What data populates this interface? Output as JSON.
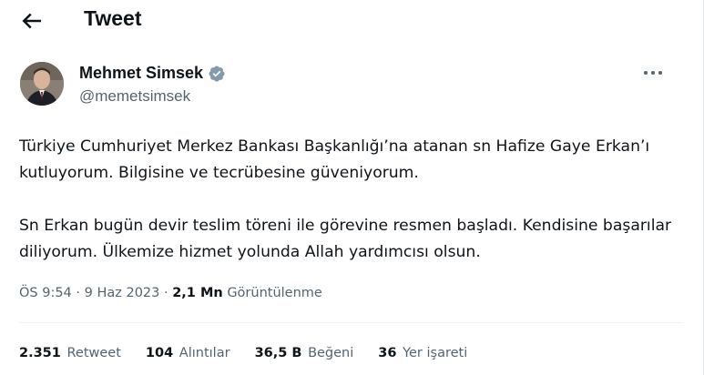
{
  "header": {
    "title": "Tweet",
    "back_icon": "arrow-left-icon"
  },
  "author": {
    "name": "Mehmet Simsek",
    "handle": "@memetsimsek",
    "verified_icon": "verified-badge-icon",
    "verified_color": "#829aab",
    "more_icon": "more-horizontal-icon"
  },
  "tweet": {
    "paragraph_1": "Türkiye Cumhuriyet Merkez Bankası Başkanlığı’na atanan sn Hafize Gaye Erkan’ı kutluyorum. Bilgisine ve tecrübesine güveniyorum.",
    "paragraph_2": "Sn Erkan bugün devir teslim töreni ile görevine resmen başladı. Kendisine başarılar diliyorum. Ülkemize hizmet yolunda Allah yardımcısı olsun."
  },
  "meta": {
    "time": "ÖS 9:54",
    "separator_1": " · ",
    "date": "9 Haz 2023",
    "separator_2": " · ",
    "views_count": "2,1 Mn",
    "views_label": "Görüntülenme"
  },
  "stats": {
    "retweets_count": "2.351",
    "retweets_label": "Retweet",
    "quotes_count": "104",
    "quotes_label": "Alıntılar",
    "likes_count": "36,5 B",
    "likes_label": "Beğeni",
    "bookmarks_count": "36",
    "bookmarks_label": "Yer işareti"
  },
  "colors": {
    "text_primary": "#0f1419",
    "text_secondary": "#536471",
    "divider": "#eff3f4"
  }
}
